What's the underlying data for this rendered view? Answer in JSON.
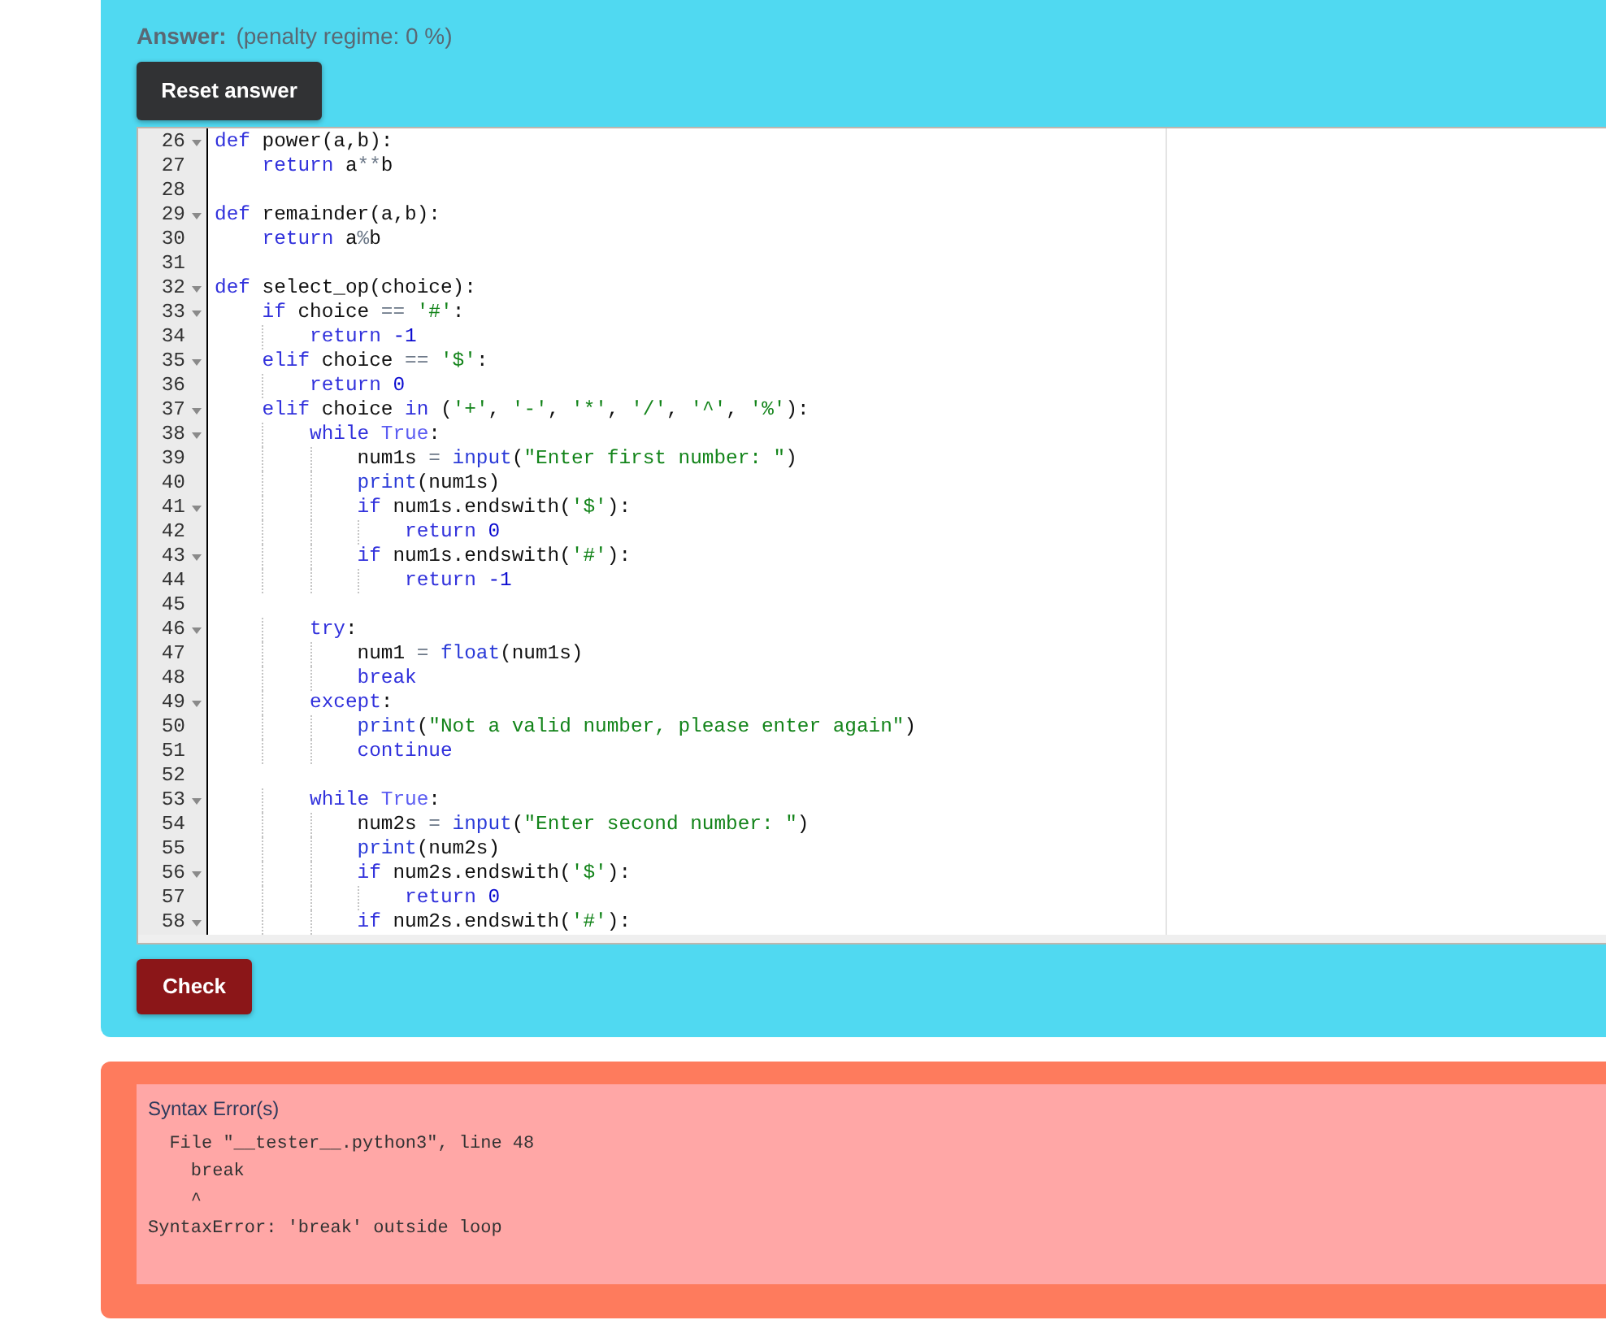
{
  "answer": {
    "label": "Answer:",
    "note": "(penalty regime: 0 %)"
  },
  "reset_button": {
    "label": "Reset answer"
  },
  "editor": {
    "lines": [
      {
        "number": "26",
        "fold": true,
        "tokens": [
          {
            "kind": "keyword",
            "text": "def"
          },
          {
            "kind": "plain",
            "text": " power(a,b):"
          }
        ]
      },
      {
        "number": "27",
        "fold": false,
        "tokens": [
          {
            "kind": "keyword",
            "text": "    return"
          },
          {
            "kind": "plain",
            "text": " a"
          },
          {
            "kind": "operator",
            "text": "**"
          },
          {
            "kind": "plain",
            "text": "b"
          }
        ]
      },
      {
        "number": "28",
        "fold": false
      },
      {
        "number": "29",
        "fold": true,
        "tokens": [
          {
            "kind": "keyword",
            "text": "def"
          },
          {
            "kind": "plain",
            "text": " remainder(a,b):"
          }
        ]
      },
      {
        "number": "30",
        "fold": false,
        "tokens": [
          {
            "kind": "keyword",
            "text": "    return"
          },
          {
            "kind": "plain",
            "text": " a"
          },
          {
            "kind": "operator",
            "text": "%"
          },
          {
            "kind": "plain",
            "text": "b"
          }
        ]
      },
      {
        "number": "31",
        "fold": false
      },
      {
        "number": "32",
        "fold": true,
        "tokens": [
          {
            "kind": "keyword",
            "text": "def"
          },
          {
            "kind": "plain",
            "text": " select_op(choice):"
          }
        ]
      },
      {
        "number": "33",
        "fold": true,
        "tokens": [
          {
            "kind": "keyword",
            "text": "    if"
          },
          {
            "kind": "plain",
            "text": " choice "
          },
          {
            "kind": "operator",
            "text": "== "
          },
          {
            "kind": "string",
            "text": "'#'"
          },
          {
            "kind": "plain",
            "text": ":"
          }
        ]
      },
      {
        "number": "34",
        "fold": false,
        "tokens": [
          {
            "kind": "keyword",
            "text": "        return "
          },
          {
            "kind": "number",
            "text": "-1"
          }
        ]
      },
      {
        "number": "35",
        "fold": true,
        "tokens": [
          {
            "kind": "keyword",
            "text": "    elif"
          },
          {
            "kind": "plain",
            "text": " choice "
          },
          {
            "kind": "operator",
            "text": "== "
          },
          {
            "kind": "string",
            "text": "'$'"
          },
          {
            "kind": "plain",
            "text": ":"
          }
        ]
      },
      {
        "number": "36",
        "fold": false,
        "tokens": [
          {
            "kind": "keyword",
            "text": "        return "
          },
          {
            "kind": "number",
            "text": "0"
          }
        ]
      },
      {
        "number": "37",
        "fold": true,
        "tokens": [
          {
            "kind": "keyword",
            "text": "    elif"
          },
          {
            "kind": "plain",
            "text": " choice "
          },
          {
            "kind": "keyword",
            "text": "in"
          },
          {
            "kind": "plain",
            "text": " ("
          },
          {
            "kind": "string",
            "text": "'+'"
          },
          {
            "kind": "plain",
            "text": ", "
          },
          {
            "kind": "string",
            "text": "'-'"
          },
          {
            "kind": "plain",
            "text": ", "
          },
          {
            "kind": "string",
            "text": "'*'"
          },
          {
            "kind": "plain",
            "text": ", "
          },
          {
            "kind": "string",
            "text": "'/'"
          },
          {
            "kind": "plain",
            "text": ", "
          },
          {
            "kind": "string",
            "text": "'^'"
          },
          {
            "kind": "plain",
            "text": ", "
          },
          {
            "kind": "string",
            "text": "'%'"
          },
          {
            "kind": "plain",
            "text": "):"
          }
        ]
      },
      {
        "number": "38",
        "fold": true,
        "tokens": [
          {
            "kind": "keyword",
            "text": "        while "
          },
          {
            "kind": "constant",
            "text": "True"
          },
          {
            "kind": "plain",
            "text": ":"
          }
        ]
      },
      {
        "number": "39",
        "fold": false,
        "tokens": [
          {
            "kind": "plain",
            "text": "            num1s "
          },
          {
            "kind": "operator",
            "text": "= "
          },
          {
            "kind": "function",
            "text": "input"
          },
          {
            "kind": "plain",
            "text": "("
          },
          {
            "kind": "string",
            "text": "\"Enter first number: \""
          },
          {
            "kind": "plain",
            "text": ")"
          }
        ]
      },
      {
        "number": "40",
        "fold": false,
        "tokens": [
          {
            "kind": "function",
            "text": "            print"
          },
          {
            "kind": "plain",
            "text": "(num1s)"
          }
        ]
      },
      {
        "number": "41",
        "fold": true,
        "tokens": [
          {
            "kind": "keyword",
            "text": "            if"
          },
          {
            "kind": "plain",
            "text": " num1s.endswith("
          },
          {
            "kind": "string",
            "text": "'$'"
          },
          {
            "kind": "plain",
            "text": "):"
          }
        ]
      },
      {
        "number": "42",
        "fold": false,
        "tokens": [
          {
            "kind": "keyword",
            "text": "                return "
          },
          {
            "kind": "number",
            "text": "0"
          }
        ]
      },
      {
        "number": "43",
        "fold": true,
        "tokens": [
          {
            "kind": "keyword",
            "text": "            if"
          },
          {
            "kind": "plain",
            "text": " num1s.endswith("
          },
          {
            "kind": "string",
            "text": "'#'"
          },
          {
            "kind": "plain",
            "text": "):"
          }
        ]
      },
      {
        "number": "44",
        "fold": false,
        "tokens": [
          {
            "kind": "keyword",
            "text": "                return "
          },
          {
            "kind": "number",
            "text": "-1"
          }
        ]
      },
      {
        "number": "45",
        "fold": false
      },
      {
        "number": "46",
        "fold": true,
        "tokens": [
          {
            "kind": "keyword",
            "text": "        try"
          },
          {
            "kind": "plain",
            "text": ":"
          }
        ]
      },
      {
        "number": "47",
        "fold": false,
        "tokens": [
          {
            "kind": "plain",
            "text": "            num1 "
          },
          {
            "kind": "operator",
            "text": "= "
          },
          {
            "kind": "function",
            "text": "float"
          },
          {
            "kind": "plain",
            "text": "(num1s)"
          }
        ]
      },
      {
        "number": "48",
        "fold": false,
        "tokens": [
          {
            "kind": "keyword",
            "text": "            break"
          }
        ]
      },
      {
        "number": "49",
        "fold": true,
        "tokens": [
          {
            "kind": "keyword",
            "text": "        except"
          },
          {
            "kind": "plain",
            "text": ":"
          }
        ]
      },
      {
        "number": "50",
        "fold": false,
        "tokens": [
          {
            "kind": "function",
            "text": "            print"
          },
          {
            "kind": "plain",
            "text": "("
          },
          {
            "kind": "string",
            "text": "\"Not a valid number, please enter again\""
          },
          {
            "kind": "plain",
            "text": ")"
          }
        ]
      },
      {
        "number": "51",
        "fold": false,
        "tokens": [
          {
            "kind": "keyword",
            "text": "            continue"
          }
        ]
      },
      {
        "number": "52",
        "fold": false
      },
      {
        "number": "53",
        "fold": true,
        "tokens": [
          {
            "kind": "keyword",
            "text": "        while "
          },
          {
            "kind": "constant",
            "text": "True"
          },
          {
            "kind": "plain",
            "text": ":"
          }
        ]
      },
      {
        "number": "54",
        "fold": false,
        "tokens": [
          {
            "kind": "plain",
            "text": "            num2s "
          },
          {
            "kind": "operator",
            "text": "= "
          },
          {
            "kind": "function",
            "text": "input"
          },
          {
            "kind": "plain",
            "text": "("
          },
          {
            "kind": "string",
            "text": "\"Enter second number: \""
          },
          {
            "kind": "plain",
            "text": ")"
          }
        ]
      },
      {
        "number": "55",
        "fold": false,
        "tokens": [
          {
            "kind": "function",
            "text": "            print"
          },
          {
            "kind": "plain",
            "text": "(num2s)"
          }
        ]
      },
      {
        "number": "56",
        "fold": true,
        "tokens": [
          {
            "kind": "keyword",
            "text": "            if"
          },
          {
            "kind": "plain",
            "text": " num2s.endswith("
          },
          {
            "kind": "string",
            "text": "'$'"
          },
          {
            "kind": "plain",
            "text": "):"
          }
        ]
      },
      {
        "number": "57",
        "fold": false,
        "tokens": [
          {
            "kind": "keyword",
            "text": "                return "
          },
          {
            "kind": "number",
            "text": "0"
          }
        ]
      },
      {
        "number": "58",
        "fold": true,
        "tokens": [
          {
            "kind": "keyword",
            "text": "            if"
          },
          {
            "kind": "plain",
            "text": " num2s.endswith("
          },
          {
            "kind": "string",
            "text": "'#'"
          },
          {
            "kind": "plain",
            "text": "):"
          }
        ]
      }
    ]
  },
  "check_button": {
    "label": "Check"
  },
  "feedback": {
    "title": "Syntax Error(s)",
    "traceback": [
      "  File \"__tester__.python3\", line 48",
      "    break",
      "    ^",
      "SyntaxError: 'break' outside loop"
    ]
  }
}
